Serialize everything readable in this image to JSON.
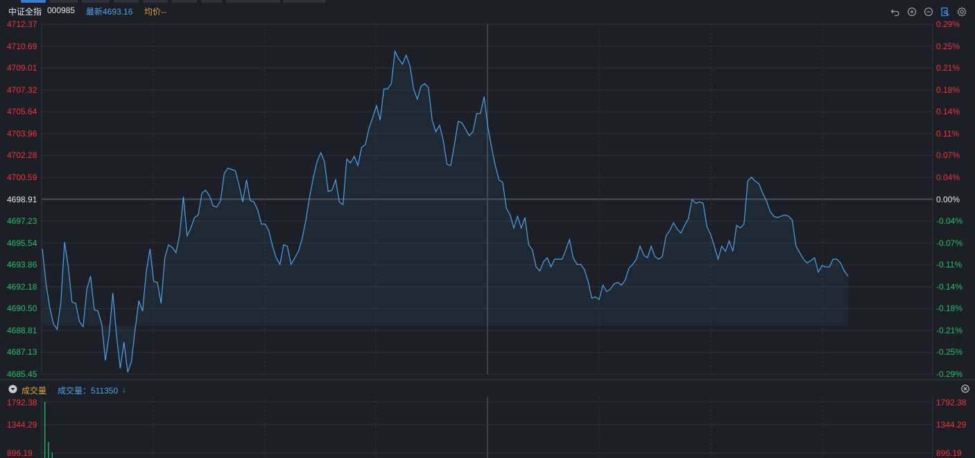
{
  "header": {
    "index_name": "中证全指",
    "index_code": "000985",
    "latest": "最新4693.16",
    "avg": "均价--"
  },
  "toolbar": [
    "undo-icon",
    "zoom-in-icon",
    "zoom-out-icon",
    "bookmark-icon",
    "settings-icon"
  ],
  "price_axis": {
    "left": [
      "4712.37",
      "4710.69",
      "4709.01",
      "4707.32",
      "4705.64",
      "4703.96",
      "4702.28",
      "4700.59",
      "4698.91",
      "4697.23",
      "4695.54",
      "4693.86",
      "4692.18",
      "4690.50",
      "4688.81",
      "4687.13",
      "4685.45"
    ],
    "right": [
      "0.29%",
      "0.25%",
      "0.21%",
      "0.18%",
      "0.14%",
      "0.11%",
      "0.07%",
      "0.04%",
      "0.00%",
      "-0.04%",
      "-0.07%",
      "-0.11%",
      "-0.14%",
      "-0.18%",
      "-0.21%",
      "-0.25%",
      "-0.29%"
    ]
  },
  "volume": {
    "title": "成交量",
    "label": "成交量：511350",
    "arrow": "↓",
    "axis_left": [
      "1792.38",
      "1344.29",
      "896.19"
    ],
    "axis_right": [
      "1792.38",
      "1344.29",
      "896.19"
    ]
  },
  "colors": {
    "bg": "#1c1f26",
    "up": "#f0353b",
    "down": "#1fc26b",
    "line": "#4fa3e9",
    "grid": "#2f343e"
  },
  "chart_data": {
    "type": "line",
    "title": "",
    "ylim": [
      4685.45,
      4712.37
    ],
    "baseline": 4698.91,
    "series": [
      {
        "values": [
          4695.1,
          4692.4,
          4690.6,
          4689.3,
          4688.9,
          4691.0,
          4695.6,
          4693.7,
          4691.0,
          4690.9,
          4689.5,
          4689.1,
          4692.0,
          4693.0,
          4690.4,
          4690.3,
          4689.3,
          4686.5,
          4688.5,
          4691.7,
          4688.4,
          4685.9,
          4687.9,
          4685.6,
          4686.4,
          4688.9,
          4691.1,
          4690.3,
          4693.3,
          4695.1,
          4692.6,
          4692.5,
          4690.9,
          4694.4,
          4695.4,
          4695.2,
          4694.8,
          4696.2,
          4699.1,
          4696.1,
          4696.7,
          4697.5,
          4697.7,
          4699.4,
          4699.6,
          4699.2,
          4698.4,
          4698.3,
          4698.8,
          4700.9,
          4701.3,
          4701.2,
          4701.1,
          4700.0,
          4698.7,
          4700.4,
          4698.8,
          4698.7,
          4698.1,
          4697.0,
          4697.0,
          4696.5,
          4695.3,
          4694.4,
          4693.9,
          4695.4,
          4695.3,
          4693.9,
          4694.4,
          4694.9,
          4695.9,
          4697.3,
          4699.1,
          4700.6,
          4701.8,
          4702.5,
          4701.8,
          4699.5,
          4699.6,
          4700.4,
          4698.7,
          4698.5,
          4702.0,
          4701.7,
          4702.2,
          4701.5,
          4702.9,
          4703.1,
          4704.4,
          4705.2,
          4706.1,
          4705.0,
          4707.4,
          4707.4,
          4707.8,
          4710.3,
          4709.7,
          4709.3,
          4710.0,
          4709.2,
          4707.4,
          4706.6,
          4707.6,
          4707.8,
          4707.5,
          4705.0,
          4704.1,
          4704.6,
          4703.4,
          4701.6,
          4701.5,
          4703.1,
          4704.9,
          4704.8,
          4704.3,
          4703.8,
          4704.1,
          4705.5,
          4705.5,
          4706.8,
          4704.5,
          4702.9,
          4701.5,
          4700.4,
          4700.2,
          4698.2,
          4697.7,
          4696.7,
          4697.6,
          4696.7,
          4697.5,
          4695.4,
          4695.0,
          4693.7,
          4693.4,
          4694.1,
          4694.4,
          4693.7,
          4694.3,
          4694.3,
          4694.3,
          4695.0,
          4695.8,
          4694.4,
          4693.9,
          4693.9,
          4693.5,
          4692.6,
          4691.3,
          4691.4,
          4691.2,
          4692.3,
          4691.8,
          4692.0,
          4692.4,
          4692.5,
          4692.3,
          4692.7,
          4693.6,
          4693.9,
          4694.3,
          4695.3,
          4694.6,
          4694.4,
          4695.3,
          4694.5,
          4694.3,
          4694.5,
          4696.1,
          4696.5,
          4697.1,
          4696.6,
          4696.3,
          4696.9,
          4697.4,
          4698.9,
          4698.6,
          4698.7,
          4698.6,
          4696.8,
          4696.2,
          4695.3,
          4694.3,
          4695.3,
          4694.9,
          4695.7,
          4694.9,
          4696.9,
          4696.7,
          4697.0,
          4700.3,
          4700.6,
          4700.3,
          4700.1,
          4699.4,
          4698.8,
          4698.0,
          4697.6,
          4697.5,
          4697.6,
          4697.7,
          4697.6,
          4697.3,
          4695.3,
          4694.8,
          4694.3,
          4694.0,
          4694.2,
          4694.4,
          4693.3,
          4693.8,
          4693.7,
          4693.7,
          4694.3,
          4694.3,
          4694.0,
          4693.4,
          4693.0
        ]
      }
    ],
    "volume_ylim": [
      896.19,
      1792.38
    ],
    "volume_bars": [
      1792.38,
      1090,
      905
    ]
  }
}
